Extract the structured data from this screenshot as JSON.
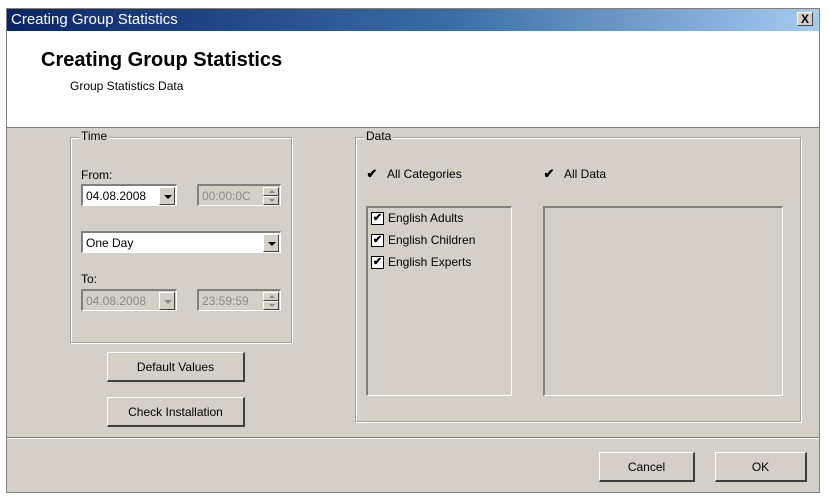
{
  "window": {
    "title": "Creating Group Statistics",
    "close_label": "X"
  },
  "header": {
    "title": "Creating Group Statistics",
    "subtitle": "Group Statistics Data"
  },
  "time": {
    "legend": "Time",
    "from_label": "From:",
    "from_date": "04.08.2008",
    "from_time": "00:00:0C",
    "period": "One Day",
    "to_label": "To:",
    "to_date": "04.08.2008",
    "to_time": "23:59:59"
  },
  "buttons": {
    "default_values": "Default Values",
    "check_installation": "Check Installation",
    "cancel": "Cancel",
    "ok": "OK"
  },
  "data": {
    "legend": "Data",
    "all_categories": {
      "label": "All Categories",
      "checked": true
    },
    "all_data": {
      "label": "All Data",
      "checked": true
    },
    "categories": [
      {
        "label": "English Adults",
        "checked": true
      },
      {
        "label": "English Children",
        "checked": true
      },
      {
        "label": "English Experts",
        "checked": true
      }
    ]
  },
  "icons": {
    "check_mark": "✔",
    "close": "close-icon",
    "dropdown": "chevron-down-icon"
  }
}
